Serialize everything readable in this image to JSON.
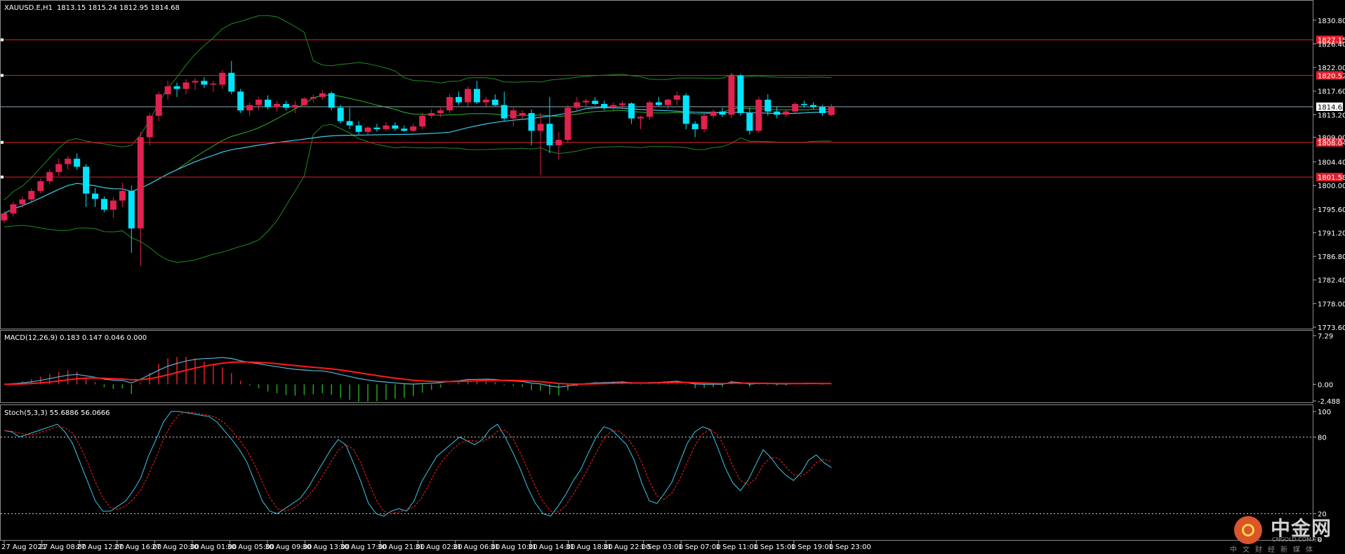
{
  "header": {
    "symbol": "XAUUSD.E,H1",
    "ohlc": "1813.15 1815.24 1812.95 1814.68"
  },
  "indicators": {
    "macd_label": "MACD(12,26,9) 0.183 0.147 0.046 0.000",
    "stoch_label": "Stoch(5,3,3) 55.6886 56.0666"
  },
  "chart_data": [
    {
      "type": "candlestick",
      "panel": "price",
      "ylim": [
        1773.6,
        1833.0
      ],
      "y_ticks": [
        "1830.80",
        "1826.40",
        "1822.00",
        "1817.60",
        "1813.20",
        "1809.00",
        "1804.40",
        "1800.00",
        "1795.60",
        "1791.20",
        "1786.80",
        "1782.40",
        "1778.00",
        "1773.60"
      ],
      "x_ticks": [
        "27 Aug 2021",
        "27 Aug 08:00",
        "27 Aug 12:00",
        "27 Aug 16:00",
        "27 Aug 20:00",
        "30 Aug 01:00",
        "30 Aug 05:00",
        "30 Aug 09:00",
        "30 Aug 13:00",
        "30 Aug 17:00",
        "30 Aug 21:00",
        "31 Aug 02:00",
        "31 Aug 06:00",
        "31 Aug 10:00",
        "31 Aug 14:00",
        "31 Aug 18:00",
        "31 Aug 22:00",
        "1 Sep 03:00",
        "1 Sep 07:00",
        "1 Sep 11:00",
        "1 Sep 15:00",
        "1 Sep 19:00",
        "1 Sep 23:00"
      ],
      "current_price": "1814.68",
      "levels": [
        {
          "value": 1827.15,
          "label": "1827.15"
        },
        {
          "value": 1820.52,
          "label": "1820.52"
        },
        {
          "value": 1808.04,
          "label": "1808.04"
        },
        {
          "value": 1801.58,
          "label": "1801.58"
        }
      ],
      "candles": [
        [
          1793.5,
          1795.2,
          1793.0,
          1794.8
        ],
        [
          1794.8,
          1797.0,
          1794.2,
          1796.5
        ],
        [
          1796.5,
          1798.0,
          1795.9,
          1797.4
        ],
        [
          1797.4,
          1799.5,
          1797.0,
          1799.0
        ],
        [
          1799.0,
          1801.3,
          1798.5,
          1800.8
        ],
        [
          1800.8,
          1803.0,
          1800.2,
          1802.5
        ],
        [
          1802.5,
          1805.0,
          1801.8,
          1804.0
        ],
        [
          1804.0,
          1805.5,
          1803.0,
          1805.0
        ],
        [
          1805.0,
          1806.0,
          1803.0,
          1803.5
        ],
        [
          1803.5,
          1804.0,
          1796.0,
          1798.5
        ],
        [
          1798.5,
          1799.5,
          1796.0,
          1797.5
        ],
        [
          1797.5,
          1798.0,
          1795.0,
          1795.5
        ],
        [
          1795.5,
          1797.8,
          1794.0,
          1797.2
        ],
        [
          1797.2,
          1800.5,
          1796.0,
          1799.0
        ],
        [
          1799.0,
          1800.0,
          1787.5,
          1792.0
        ],
        [
          1792.0,
          1810.0,
          1785.0,
          1809.0
        ],
        [
          1809.0,
          1813.5,
          1807.5,
          1813.0
        ],
        [
          1813.0,
          1817.5,
          1812.0,
          1817.0
        ],
        [
          1817.0,
          1819.5,
          1816.0,
          1818.5
        ],
        [
          1818.5,
          1819.2,
          1816.5,
          1818.0
        ],
        [
          1818.0,
          1819.8,
          1817.0,
          1819.2
        ],
        [
          1819.2,
          1820.0,
          1817.8,
          1819.5
        ],
        [
          1819.5,
          1820.2,
          1818.2,
          1818.8
        ],
        [
          1818.8,
          1819.5,
          1817.5,
          1819.0
        ],
        [
          1818.8,
          1821.5,
          1818.0,
          1821.0
        ],
        [
          1821.0,
          1823.2,
          1817.0,
          1817.5
        ],
        [
          1817.5,
          1818.0,
          1813.5,
          1814.0
        ],
        [
          1814.0,
          1815.5,
          1813.0,
          1815.0
        ],
        [
          1815.0,
          1816.5,
          1814.0,
          1816.0
        ],
        [
          1816.0,
          1816.8,
          1814.2,
          1814.6
        ],
        [
          1814.6,
          1815.8,
          1813.8,
          1815.2
        ],
        [
          1815.2,
          1815.8,
          1814.0,
          1814.5
        ],
        [
          1814.5,
          1815.8,
          1813.5,
          1815.0
        ],
        [
          1815.0,
          1816.5,
          1814.8,
          1816.2
        ],
        [
          1816.2,
          1817.0,
          1815.5,
          1816.5
        ],
        [
          1816.5,
          1817.8,
          1816.0,
          1817.2
        ],
        [
          1817.2,
          1817.5,
          1814.0,
          1814.5
        ],
        [
          1814.5,
          1815.0,
          1811.5,
          1812.0
        ],
        [
          1812.0,
          1814.5,
          1810.5,
          1811.2
        ],
        [
          1811.2,
          1812.0,
          1809.5,
          1810.0
        ],
        [
          1810.0,
          1811.0,
          1809.2,
          1810.8
        ],
        [
          1810.8,
          1811.5,
          1810.0,
          1810.5
        ],
        [
          1810.5,
          1811.8,
          1810.2,
          1811.2
        ],
        [
          1811.2,
          1811.8,
          1810.2,
          1810.6
        ],
        [
          1810.6,
          1811.2,
          1810.0,
          1810.2
        ],
        [
          1810.2,
          1811.5,
          1810.0,
          1811.0
        ],
        [
          1811.0,
          1813.5,
          1810.5,
          1813.0
        ],
        [
          1813.0,
          1814.2,
          1812.5,
          1813.5
        ],
        [
          1813.5,
          1814.5,
          1812.8,
          1814.0
        ],
        [
          1814.0,
          1817.0,
          1813.5,
          1816.5
        ],
        [
          1816.5,
          1817.5,
          1815.0,
          1815.5
        ],
        [
          1815.5,
          1818.5,
          1814.5,
          1818.0
        ],
        [
          1818.0,
          1819.5,
          1815.2,
          1815.5
        ],
        [
          1815.5,
          1816.5,
          1814.5,
          1816.0
        ],
        [
          1816.0,
          1817.0,
          1814.8,
          1815.0
        ],
        [
          1815.0,
          1817.5,
          1812.0,
          1812.5
        ],
        [
          1812.5,
          1814.5,
          1811.0,
          1814.0
        ],
        [
          1813.0,
          1814.0,
          1812.5,
          1813.5
        ],
        [
          1813.5,
          1814.2,
          1807.5,
          1810.2
        ],
        [
          1810.2,
          1813.5,
          1802.0,
          1811.5
        ],
        [
          1811.5,
          1816.5,
          1806.0,
          1807.5
        ],
        [
          1807.5,
          1810.0,
          1804.8,
          1808.5
        ],
        [
          1808.5,
          1815.0,
          1808.0,
          1814.5
        ],
        [
          1814.5,
          1816.5,
          1814.0,
          1815.5
        ],
        [
          1815.5,
          1816.2,
          1814.8,
          1815.8
        ],
        [
          1815.8,
          1816.5,
          1815.0,
          1815.2
        ],
        [
          1815.2,
          1815.8,
          1814.0,
          1814.5
        ],
        [
          1814.5,
          1815.5,
          1813.8,
          1815.0
        ],
        [
          1815.0,
          1815.8,
          1814.2,
          1815.3
        ],
        [
          1815.3,
          1815.5,
          1811.5,
          1812.5
        ],
        [
          1812.5,
          1813.0,
          1810.5,
          1812.8
        ],
        [
          1812.8,
          1815.8,
          1812.2,
          1815.5
        ],
        [
          1815.5,
          1816.5,
          1814.8,
          1815.0
        ],
        [
          1815.0,
          1816.2,
          1814.2,
          1816.0
        ],
        [
          1816.0,
          1817.5,
          1815.0,
          1816.8
        ],
        [
          1816.8,
          1817.2,
          1810.5,
          1811.5
        ],
        [
          1811.5,
          1812.0,
          1809.0,
          1810.5
        ],
        [
          1810.5,
          1813.5,
          1810.0,
          1813.0
        ],
        [
          1813.0,
          1814.2,
          1812.5,
          1813.8
        ],
        [
          1813.8,
          1814.5,
          1812.8,
          1813.2
        ],
        [
          1813.2,
          1821.0,
          1812.5,
          1820.5
        ],
        [
          1820.5,
          1820.8,
          1813.0,
          1813.5
        ],
        [
          1813.5,
          1814.5,
          1809.5,
          1810.2
        ],
        [
          1810.2,
          1816.5,
          1809.8,
          1816.0
        ],
        [
          1816.0,
          1817.0,
          1813.0,
          1813.8
        ],
        [
          1813.8,
          1814.8,
          1812.5,
          1813.2
        ],
        [
          1813.2,
          1814.2,
          1812.8,
          1813.8
        ],
        [
          1813.8,
          1815.5,
          1813.5,
          1815.2
        ],
        [
          1815.2,
          1815.8,
          1814.5,
          1815.0
        ],
        [
          1815.0,
          1815.5,
          1814.2,
          1814.6
        ],
        [
          1814.6,
          1815.0,
          1813.0,
          1813.5
        ],
        [
          1813.15,
          1815.24,
          1812.95,
          1814.68
        ]
      ]
    },
    {
      "type": "macd",
      "panel": "macd",
      "y_ticks": [
        "7.29",
        "0.00",
        "-2.488"
      ],
      "ylim": [
        -2.488,
        7.29
      ]
    },
    {
      "type": "stochastic",
      "panel": "stoch",
      "y_ticks": [
        "100",
        "80",
        "20",
        "0"
      ],
      "ylim": [
        0,
        100
      ],
      "levels": [
        80,
        20
      ],
      "main": [
        85,
        84,
        80,
        82,
        84,
        86,
        88,
        90,
        84,
        75,
        60,
        45,
        30,
        22,
        22,
        26,
        30,
        38,
        48,
        65,
        78,
        92,
        100,
        100,
        99,
        98,
        97,
        96,
        92,
        85,
        78,
        70,
        60,
        45,
        30,
        22,
        20,
        24,
        28,
        32,
        40,
        50,
        60,
        70,
        78,
        74,
        60,
        45,
        28,
        20,
        18,
        22,
        24,
        22,
        30,
        45,
        55,
        65,
        70,
        75,
        80,
        77,
        74,
        78,
        86,
        90,
        80,
        68,
        55,
        40,
        28,
        20,
        18,
        26,
        35,
        46,
        55,
        68,
        80,
        88,
        86,
        80,
        74,
        62,
        44,
        30,
        28,
        36,
        45,
        60,
        75,
        84,
        88,
        86,
        72,
        56,
        44,
        38,
        46,
        58,
        70,
        64,
        56,
        50,
        46,
        52,
        62,
        66,
        60,
        56
      ]
    }
  ]
}
